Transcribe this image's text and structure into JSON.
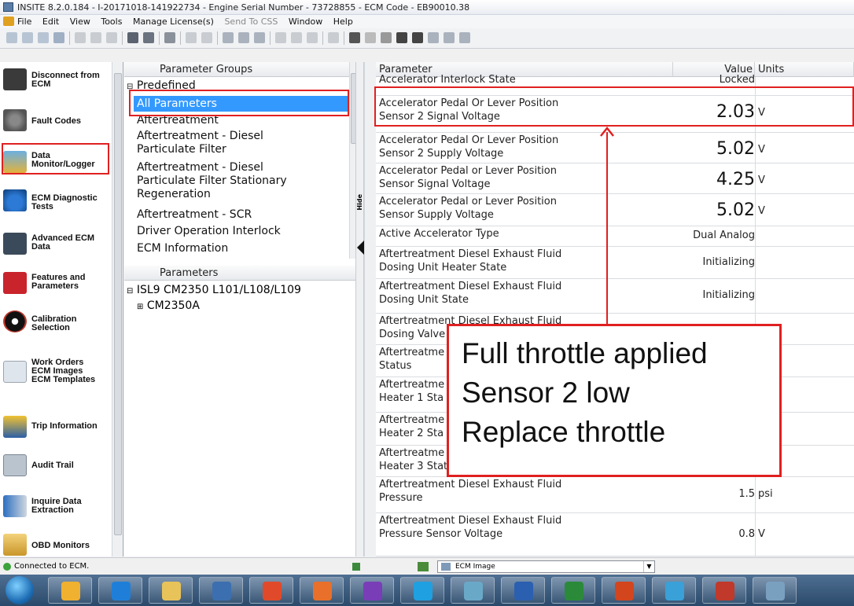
{
  "window": {
    "title": "INSITE 8.2.0.184 - I-20171018-141922734 - Engine Serial Number - 73728855 - ECM Code - EB90010.38"
  },
  "menu": [
    "File",
    "Edit",
    "View",
    "Tools",
    "Manage License(s)",
    "Send To CSS",
    "Window",
    "Help"
  ],
  "sidebar": [
    {
      "label": "Disconnect from\nECM",
      "icon": "disconnect-icon"
    },
    {
      "label": "Fault Codes",
      "icon": "fault-codes-icon"
    },
    {
      "label": "Data\nMonitor/Logger",
      "icon": "data-monitor-icon"
    },
    {
      "label": "ECM Diagnostic\nTests",
      "icon": "diagnostic-tests-icon"
    },
    {
      "label": "Advanced ECM\nData",
      "icon": "advanced-data-icon"
    },
    {
      "label": "Features and\nParameters",
      "icon": "features-icon"
    },
    {
      "label": "Calibration\nSelection",
      "icon": "calibration-icon"
    },
    {
      "label": "Work Orders\nECM Images\nECM Templates",
      "icon": "work-orders-icon"
    },
    {
      "label": "Trip Information",
      "icon": "trip-info-icon"
    },
    {
      "label": "Audit Trail",
      "icon": "audit-trail-icon"
    },
    {
      "label": "Inquire Data\nExtraction",
      "icon": "inquire-data-icon"
    },
    {
      "label": "OBD Monitors",
      "icon": "obd-monitors-icon"
    }
  ],
  "groups": {
    "header": "Parameter Groups",
    "root": "Predefined",
    "items": [
      "All Parameters",
      "Aftertreatment",
      "Aftertreatment - Diesel\nParticulate Filter",
      "Aftertreatment - Diesel\nParticulate Filter Stationary\nRegeneration",
      "Aftertreatment - SCR",
      "Driver Operation Interlock",
      "ECM Information"
    ]
  },
  "params_pane": {
    "header": "Parameters",
    "root": "ISL9 CM2350 L101/L108/L109",
    "child": "CM2350A"
  },
  "hide_label": "Hide",
  "table": {
    "headers": {
      "parameter": "Parameter",
      "value": "Value",
      "units": "Units"
    },
    "rows": [
      {
        "parameter": "Accelerator Interlock State",
        "value": "Locked",
        "units": ""
      },
      {
        "parameter": "Accelerator Pedal Or Lever Position\nSensor 2 Signal Voltage",
        "value": "2.03",
        "units": "V"
      },
      {
        "parameter": "Accelerator Pedal Or Lever Position\nSensor 2 Supply Voltage",
        "value": "5.02",
        "units": "V"
      },
      {
        "parameter": "Accelerator Pedal or Lever Position\nSensor Signal Voltage",
        "value": "4.25",
        "units": "V"
      },
      {
        "parameter": "Accelerator Pedal or Lever Position\nSensor Supply Voltage",
        "value": "5.02",
        "units": "V"
      },
      {
        "parameter": "Active Accelerator Type",
        "value": "Dual Analog",
        "units": ""
      },
      {
        "parameter": "Aftertreatment Diesel Exhaust Fluid\nDosing Unit Heater State",
        "value": "Initializing",
        "units": ""
      },
      {
        "parameter": "Aftertreatment Diesel Exhaust Fluid\nDosing Unit State",
        "value": "Initializing",
        "units": ""
      },
      {
        "parameter": "Aftertreatment Diesel Exhaust Fluid\nDosing Valve",
        "value": "",
        "units": ""
      },
      {
        "parameter": "Aftertreatme\nStatus",
        "value": "",
        "units": ""
      },
      {
        "parameter": "Aftertreatme\nHeater 1 Sta",
        "value": "",
        "units": ""
      },
      {
        "parameter": "Aftertreatme\nHeater 2 Sta",
        "value": "",
        "units": ""
      },
      {
        "parameter": "Aftertreatme\nHeater 3 Status",
        "value": "",
        "units": ""
      },
      {
        "parameter": "Aftertreatment Diesel Exhaust Fluid\nPressure",
        "value": "1.5",
        "units": "psi"
      },
      {
        "parameter": "Aftertreatment Diesel Exhaust Fluid\nPressure Sensor Voltage",
        "value": "0.8",
        "units": "V"
      }
    ]
  },
  "annotation": {
    "lines": [
      "Full throttle applied",
      "Sensor 2 low",
      "Replace throttle"
    ],
    "color": "#e02020"
  },
  "status": {
    "text": "Connected to ECM.",
    "combo": "ECM Image"
  },
  "taskbar": [
    "start-orb",
    "outlook-icon",
    "internet-explorer-icon",
    "file-explorer-icon",
    "network-icon",
    "chrome-icon",
    "office-icon",
    "onenote-icon",
    "skype-icon",
    "tablet-icon",
    "word-icon",
    "excel-icon",
    "powerpoint-icon",
    "desktop-icon",
    "snipping-icon",
    "insite-icon"
  ]
}
